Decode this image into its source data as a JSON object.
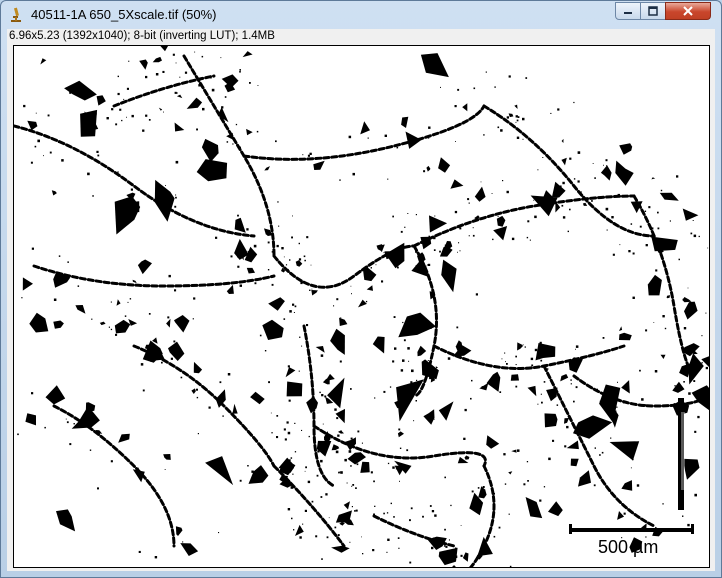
{
  "window": {
    "title": "40511-1A 650_5Xscale.tif (50%)",
    "info": "6.96x5.23  (1392x1040); 8-bit (inverting LUT); 1.4MB"
  },
  "controls": {
    "minimize_icon": "minimize-icon",
    "maximize_icon": "maximize-icon",
    "close_icon": "close-icon"
  },
  "image": {
    "scale_bar_label": "500 µm"
  },
  "colors": {
    "titlebar": "#b9cfe6",
    "close_button": "#c9462c",
    "canvas_background": "#ffffff",
    "particles": "#000000"
  }
}
